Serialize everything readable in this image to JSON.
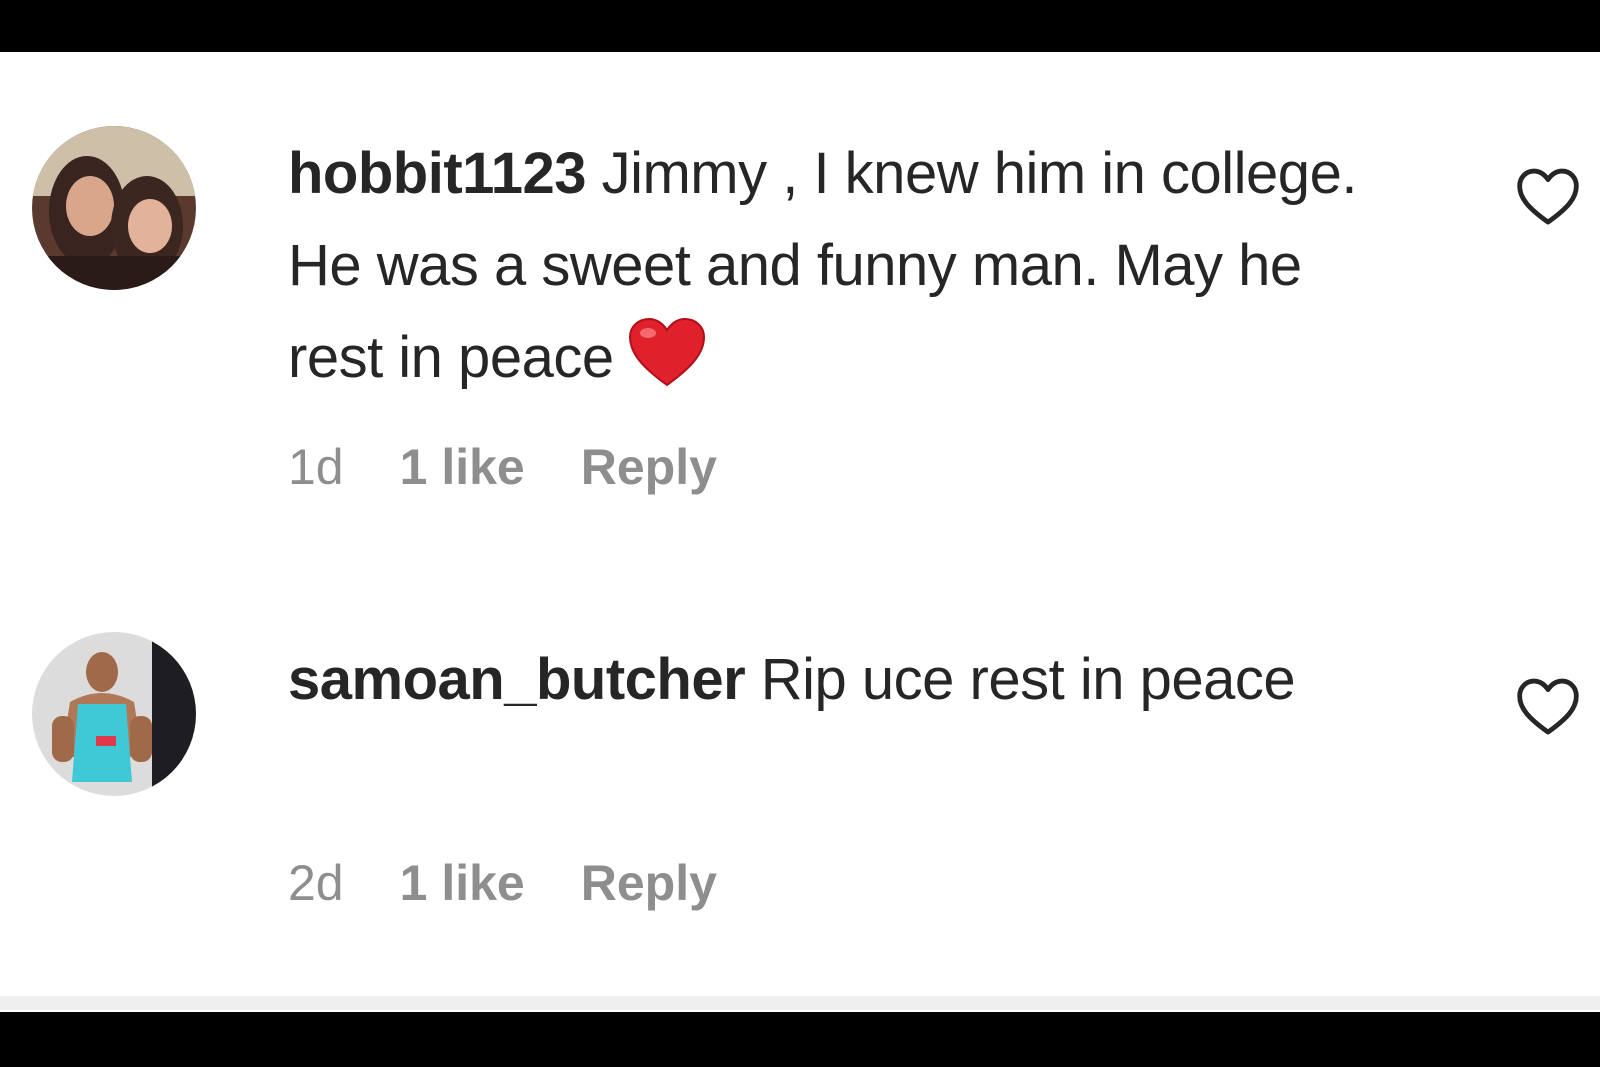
{
  "comments": [
    {
      "username": "hobbit1123",
      "text": " Jimmy , I knew him in college. He was a sweet and funny man. May he rest in peace",
      "emoji": "red-heart",
      "time": "1d",
      "likes": "1 like",
      "reply_label": "Reply"
    },
    {
      "username": "samoan_butcher",
      "text": " Rip uce rest in peace",
      "time": "2d",
      "likes": "1 like",
      "reply_label": "Reply"
    }
  ],
  "icons": {
    "like": "heart-outline-icon",
    "emoji": "red-heart-emoji"
  },
  "colors": {
    "text": "#262626",
    "meta": "#8e8e8e",
    "emoji_heart": "#e0202a",
    "background": "#ffffff",
    "frame": "#000000"
  }
}
